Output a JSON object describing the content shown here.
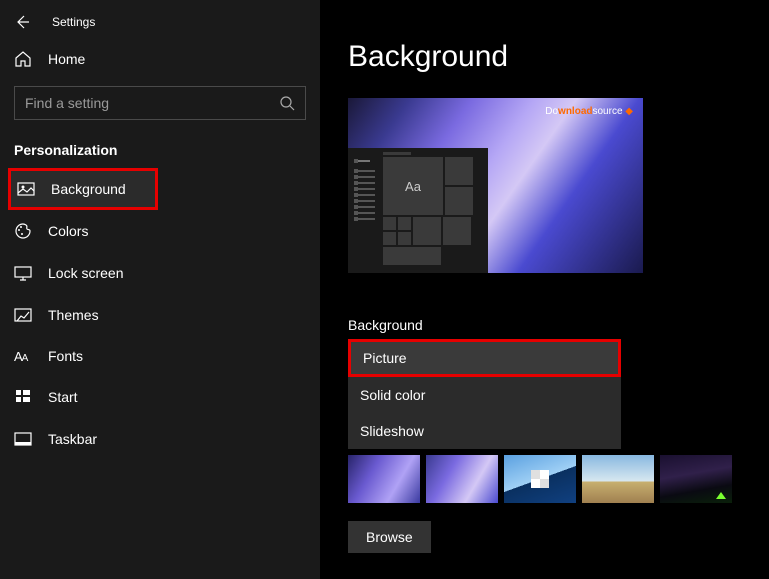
{
  "titlebar": {
    "label": "Settings"
  },
  "home": {
    "label": "Home"
  },
  "search": {
    "placeholder": "Find a setting"
  },
  "category": "Personalization",
  "nav": [
    {
      "label": "Background",
      "icon": "picture-icon",
      "selected": true
    },
    {
      "label": "Colors",
      "icon": "palette-icon"
    },
    {
      "label": "Lock screen",
      "icon": "monitor-icon"
    },
    {
      "label": "Themes",
      "icon": "paintbrush-icon"
    },
    {
      "label": "Fonts",
      "icon": "fonts-icon"
    },
    {
      "label": "Start",
      "icon": "start-icon"
    },
    {
      "label": "Taskbar",
      "icon": "taskbar-icon"
    }
  ],
  "main": {
    "heading": "Background",
    "preview": {
      "watermark_pre": "Do",
      "watermark_bold": "wnload",
      "watermark_post": "source",
      "tile_text": "Aa"
    },
    "dropdown": {
      "label": "Background",
      "selected": "Picture",
      "options": [
        "Picture",
        "Solid color",
        "Slideshow"
      ]
    },
    "browse": "Browse"
  }
}
